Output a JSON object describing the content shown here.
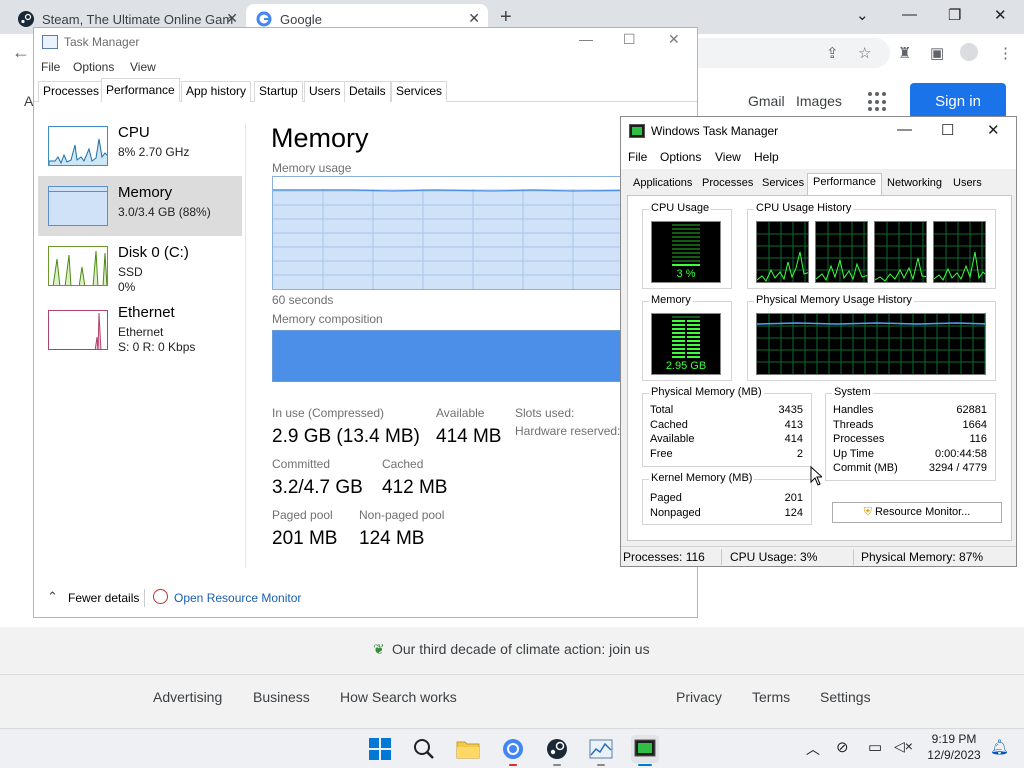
{
  "chrome": {
    "tabs": [
      {
        "title": "Steam, The Ultimate Online Gam",
        "close": "✕"
      },
      {
        "title": "Google",
        "close": "✕"
      }
    ],
    "new_tab": "+",
    "window_controls": [
      "⌄",
      "—",
      "❐",
      "✕"
    ]
  },
  "google": {
    "top_links": [
      "Gmail",
      "Images"
    ],
    "sign_in": "Sign in",
    "climate_text": "Our third decade of climate action: join us",
    "footer_left": [
      "Advertising",
      "Business",
      "How Search works"
    ],
    "footer_right": [
      "Privacy",
      "Terms",
      "Settings"
    ]
  },
  "tm_new": {
    "title": "Task Manager",
    "menu": [
      "File",
      "Options",
      "View"
    ],
    "tabs": [
      "Processes",
      "Performance",
      "App history",
      "Startup",
      "Users",
      "Details",
      "Services"
    ],
    "active_tab": "Performance",
    "sidebar": [
      {
        "name": "CPU",
        "line1": "8% 2.70 GHz",
        "line2": ""
      },
      {
        "name": "Memory",
        "line1": "3.0/3.4 GB (88%)",
        "line2": ""
      },
      {
        "name": "Disk 0 (C:)",
        "line1": "SSD",
        "line2": "0%"
      },
      {
        "name": "Ethernet",
        "line1": "Ethernet",
        "line2": "S: 0 R: 0 Kbps"
      }
    ],
    "memory": {
      "title": "Memory",
      "usage_label": "Memory usage",
      "seconds_label": "60 seconds",
      "composition_label": "Memory composition",
      "usage_fraction": 0.88,
      "stats": {
        "in_use_label": "In use (Compressed)",
        "in_use": "2.9 GB (13.4 MB)",
        "available_label": "Available",
        "available": "414 MB",
        "slots_label": "Slots used:",
        "hw_reserved_label": "Hardware reserved:",
        "committed_label": "Committed",
        "committed": "3.2/4.7 GB",
        "cached_label": "Cached",
        "cached": "412 MB",
        "paged_label": "Paged pool",
        "paged": "201 MB",
        "nonpaged_label": "Non-paged pool",
        "nonpaged": "124 MB"
      }
    },
    "footer": {
      "fewer": "Fewer details",
      "open_rm": "Open Resource Monitor"
    }
  },
  "tm_old": {
    "title": "Windows Task Manager",
    "menu": [
      "File",
      "Options",
      "View",
      "Help"
    ],
    "tabs": [
      "Applications",
      "Processes",
      "Services",
      "Performance",
      "Networking",
      "Users"
    ],
    "active_tab": "Performance",
    "cpu_usage_label": "CPU Usage",
    "cpu_usage_value": "3 %",
    "cpu_history_label": "CPU Usage History",
    "memory_label": "Memory",
    "memory_value": "2.95 GB",
    "phys_history_label": "Physical Memory Usage History",
    "physical": {
      "label": "Physical Memory (MB)",
      "rows": [
        [
          "Total",
          "3435"
        ],
        [
          "Cached",
          "413"
        ],
        [
          "Available",
          "414"
        ],
        [
          "Free",
          "2"
        ]
      ]
    },
    "system": {
      "label": "System",
      "rows": [
        [
          "Handles",
          "62881"
        ],
        [
          "Threads",
          "1664"
        ],
        [
          "Processes",
          "116"
        ],
        [
          "Up Time",
          "0:00:44:58"
        ],
        [
          "Commit (MB)",
          "3294 / 4779"
        ]
      ]
    },
    "kernel": {
      "label": "Kernel Memory (MB)",
      "rows": [
        [
          "Paged",
          "201"
        ],
        [
          "Nonpaged",
          "124"
        ]
      ]
    },
    "resource_monitor_button": "Resource Monitor...",
    "status": {
      "processes": "Processes: 116",
      "cpu": "CPU Usage: 3%",
      "memory": "Physical Memory: 87%"
    }
  },
  "taskbar": {
    "time": "9:19 PM",
    "date": "12/9/2023"
  },
  "colors": {
    "accent_blue": "#1a73e8",
    "mem_graph": "#4c8fe8",
    "green_meter": "#3cff3c"
  }
}
